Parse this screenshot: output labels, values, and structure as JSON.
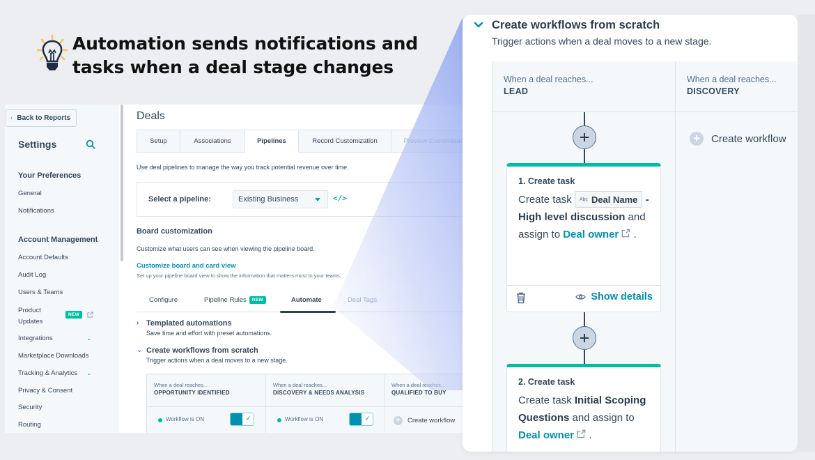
{
  "headline": {
    "icon": "lightbulb-icon",
    "line1": "Automation sends notifications and",
    "line2": "tasks when a deal stage changes"
  },
  "colors": {
    "accent_teal": "#00bda5",
    "link_blue": "#0091ae",
    "text_dark": "#33475b",
    "beam": "#a9b8f0"
  },
  "sidebar": {
    "back_label": "Back to Reports",
    "title": "Settings",
    "sections": [
      {
        "label": "Your Preferences",
        "items": [
          {
            "label": "General"
          },
          {
            "label": "Notifications"
          }
        ]
      },
      {
        "label": "Account Management",
        "items": [
          {
            "label": "Account Defaults"
          },
          {
            "label": "Audit Log"
          },
          {
            "label": "Users & Teams"
          },
          {
            "label": "Product Updates",
            "badge": "NEW",
            "external": true
          },
          {
            "label": "Integrations",
            "expandable": true
          },
          {
            "label": "Marketplace Downloads"
          },
          {
            "label": "Tracking & Analytics",
            "expandable": true
          },
          {
            "label": "Privacy & Consent"
          },
          {
            "label": "Security"
          },
          {
            "label": "Routing"
          }
        ]
      }
    ],
    "product_updates_line1": "Product",
    "product_updates_line2": "Updates"
  },
  "main": {
    "title": "Deals",
    "tabs": [
      {
        "label": "Setup"
      },
      {
        "label": "Associations"
      },
      {
        "label": "Pipelines",
        "active": true
      },
      {
        "label": "Record Customization"
      },
      {
        "label": "Preview Customizat"
      }
    ],
    "description": "Use deal pipelines to manage the way you track potential revenue over time.",
    "pipeline_label": "Select a pipeline:",
    "pipeline_value": "Existing Business",
    "code_icon_glyph": "</>",
    "board": {
      "title": "Board customization",
      "description": "Customize what users can see when viewing the pipeline board.",
      "link": "Customize board and card view",
      "link_sub": "Set up your pipeline board view to show the information that matters most to your teams."
    },
    "subtabs": [
      {
        "label": "Configure"
      },
      {
        "label": "Pipeline Rules",
        "badge": "NEW"
      },
      {
        "label": "Automate",
        "active": true
      },
      {
        "label": "Deal Tags"
      }
    ],
    "accordions": [
      {
        "title": "Templated automations",
        "description": "Save time and effort with preset automations.",
        "expanded": false
      },
      {
        "title": "Create workflows from scratch",
        "description": "Trigger actions when a deal moves to a new stage.",
        "expanded": true
      }
    ],
    "stages": [
      {
        "when": "When a deal reaches...",
        "name": "OPPORTUNITY IDENTIFIED",
        "status": "Workflow is ON",
        "enabled": true
      },
      {
        "when": "When a deal reaches...",
        "name": "DISCOVERY & NEEDS ANALYSIS",
        "status": "Workflow is ON",
        "enabled": true
      },
      {
        "when": "When a deal reaches...",
        "name": "QUALIFIED TO BUY",
        "action": "Create workflow"
      }
    ]
  },
  "zoom_panel": {
    "title": "Create workflows from scratch",
    "description": "Trigger actions when a deal moves to a new stage.",
    "columns": [
      {
        "when": "When a deal reaches...",
        "name": "LEAD",
        "tasks": [
          {
            "number": "1. Create task",
            "prefix": "Create task",
            "token_type": "Abc",
            "token": "Deal Name",
            "bold": "- High level discussion",
            "middle": " and assign to ",
            "link": "Deal owner",
            "suffix": " .",
            "show_details": "Show details"
          },
          {
            "number": "2. Create task",
            "prefix": "Create task ",
            "bold": "Initial Scoping Questions",
            "middle": " and assign to ",
            "link": "Deal owner",
            "suffix": " ."
          }
        ]
      },
      {
        "when": "When a deal reaches...",
        "name": "DISCOVERY",
        "action": "Create workflow"
      }
    ]
  }
}
